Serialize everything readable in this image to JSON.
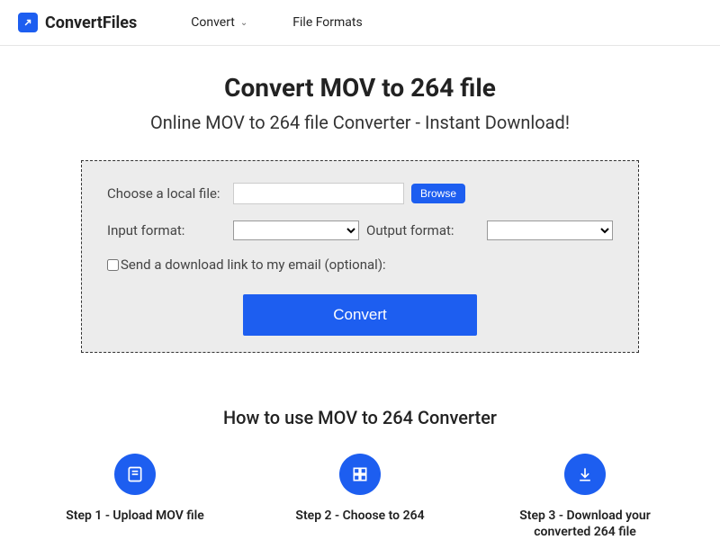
{
  "header": {
    "brand": "ConvertFiles",
    "nav": {
      "convert": "Convert",
      "formats": "File Formats"
    }
  },
  "main": {
    "title": "Convert MOV to 264 file",
    "subtitle": "Online MOV to 264 file Converter - Instant Download!"
  },
  "form": {
    "choose_label": "Choose a local file:",
    "browse_btn": "Browse",
    "input_format_label": "Input format:",
    "output_format_label": "Output format:",
    "email_checkbox_label": "Send a download link to my email (optional):",
    "convert_btn": "Convert"
  },
  "howto": {
    "title": "How to use MOV to 264 Converter",
    "steps": [
      "Step 1 - Upload MOV file",
      "Step 2 - Choose to 264",
      "Step 3 - Download your converted 264 file"
    ]
  }
}
